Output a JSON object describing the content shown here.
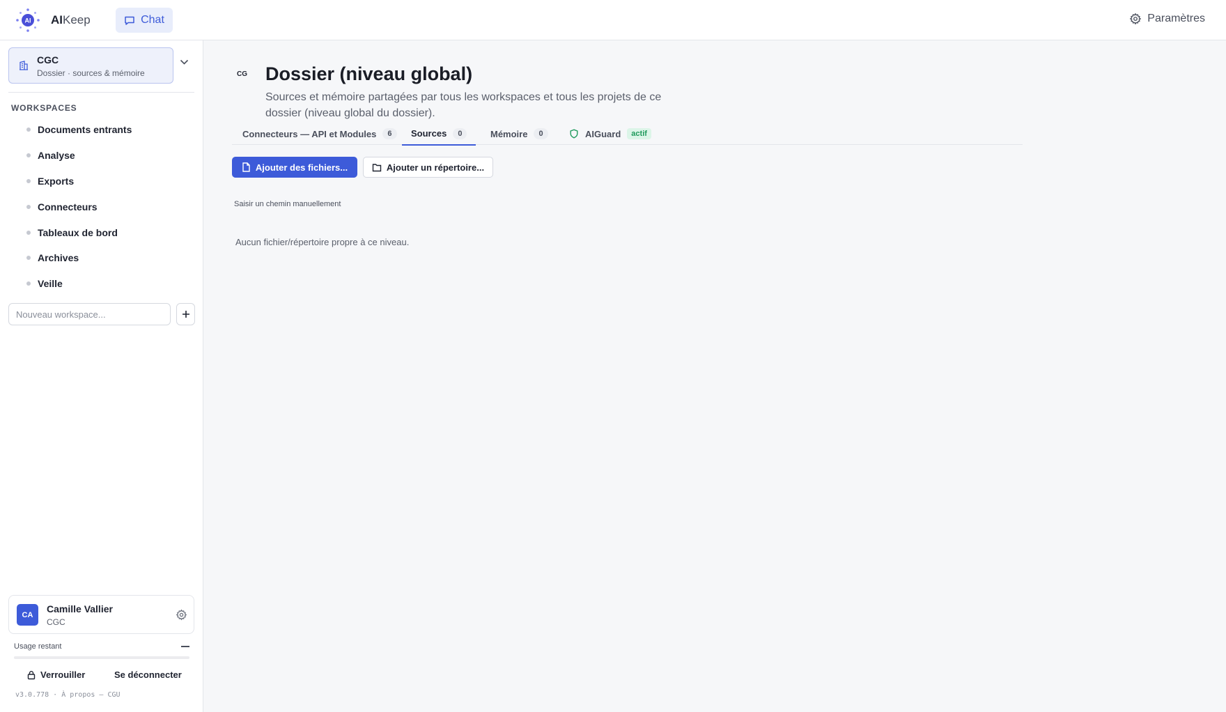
{
  "app": {
    "brand_bold": "AI",
    "brand_rest": "Keep",
    "logo_text": "AI",
    "chat_label": "Chat",
    "settings_label": "Paramètres"
  },
  "sidebar": {
    "org": {
      "name": "CGC",
      "subtitle": "Dossier · sources & mémoire"
    },
    "workspaces_title": "WORKSPACES",
    "workspaces": [
      {
        "label": "Documents entrants"
      },
      {
        "label": "Analyse"
      },
      {
        "label": "Exports"
      },
      {
        "label": "Connecteurs"
      },
      {
        "label": "Tableaux de bord"
      },
      {
        "label": "Archives"
      },
      {
        "label": "Veille"
      }
    ],
    "new_workspace_placeholder": "Nouveau workspace...",
    "user": {
      "initials": "CA",
      "name": "Camille Vallier",
      "org": "CGC"
    },
    "usage_label": "Usage restant",
    "usage_fraction": 0,
    "lock_label": "Verrouiller",
    "logout_label": "Se déconnecter",
    "version": "v3.0.778 · À propos — CGU"
  },
  "main": {
    "badge": "CG",
    "title": "Dossier (niveau global)",
    "description": "Sources et mémoire partagées par tous les workspaces et tous les projets de ce dossier (niveau global du dossier).",
    "tabs": [
      {
        "label": "Connecteurs — API et Modules",
        "count": "6"
      },
      {
        "label": "Sources",
        "count": "0"
      },
      {
        "label": "Mémoire",
        "count": "0"
      },
      {
        "label": "AIGuard",
        "status": "actif"
      }
    ],
    "add_files_label": "Ajouter des fichiers...",
    "add_folder_label": "Ajouter un répertoire...",
    "manual_path_label": "Saisir un chemin manuellement",
    "empty_message": "Aucun fichier/répertoire propre à ce niveau."
  },
  "colors": {
    "accent": "#3d5bd9",
    "accent_light": "#e8edfb",
    "success": "#1f9a5c"
  }
}
